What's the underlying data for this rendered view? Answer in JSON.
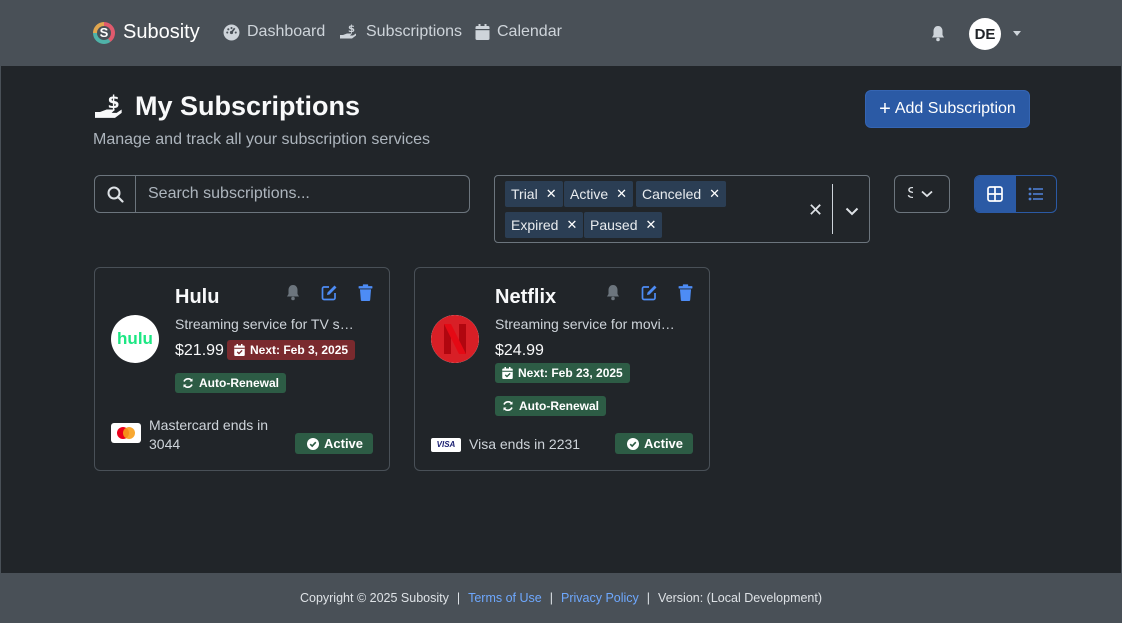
{
  "nav": {
    "brand": "Subosity",
    "brand_letter": "S",
    "links": [
      "Dashboard",
      "Subscriptions",
      "Calendar"
    ],
    "user_initials": "DE"
  },
  "header": {
    "title": "My Subscriptions",
    "subtitle": "Manage and track all your subscription services",
    "add_button": "Add Subscription"
  },
  "filters": {
    "search_placeholder": "Search subscriptions...",
    "statuses": [
      "Trial",
      "Active",
      "Canceled",
      "Expired",
      "Paused"
    ],
    "sort_value": "S"
  },
  "subscriptions": [
    {
      "name": "Hulu",
      "logo_text": "hulu",
      "description": "Streaming service for TV shows and movies",
      "price": "$21.99",
      "next_date": "Next: Feb 3, 2025",
      "auto_renewal": "Auto-Renewal",
      "payment_line1": "Mastercard ends in",
      "payment_line2": "3044",
      "status": "Active"
    },
    {
      "name": "Netflix",
      "logo_text": "N",
      "description": "Streaming service for movies and TV shows",
      "price": "$24.99",
      "next_date": "Next: Feb 23, 2025",
      "auto_renewal": "Auto-Renewal",
      "payment_line1": "Visa ends in 2231",
      "card_brand": "VISA",
      "status": "Active"
    }
  ],
  "footer": {
    "copyright": "Copyright © 2025 Subosity",
    "terms": "Terms of Use",
    "privacy": "Privacy Policy",
    "version": "Version: (Local Development)",
    "separator": "|"
  },
  "colors": {
    "background": "#212529",
    "navbar": "#495057",
    "primary": "#2b5aa5",
    "success_badge": "#2d5c45",
    "danger_badge": "#7a2a2e",
    "link": "#6ea8fe"
  }
}
